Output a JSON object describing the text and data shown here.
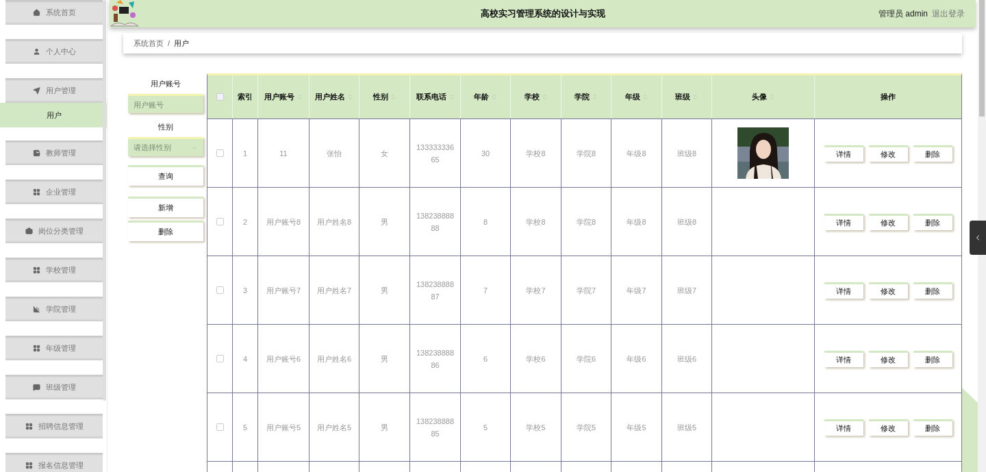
{
  "sidebar": {
    "items": [
      {
        "label": "系统首页",
        "selected": false
      },
      {
        "label": "个人中心",
        "selected": false
      },
      {
        "label": "用户管理",
        "selected": false,
        "expanded": true,
        "children": [
          {
            "label": "用户",
            "selected": true
          }
        ]
      },
      {
        "label": "教师管理",
        "selected": false
      },
      {
        "label": "企业管理",
        "selected": false
      },
      {
        "label": "岗位分类管理",
        "selected": false
      },
      {
        "label": "学校管理",
        "selected": false
      },
      {
        "label": "学院管理",
        "selected": false
      },
      {
        "label": "年级管理",
        "selected": false
      },
      {
        "label": "班级管理",
        "selected": false
      },
      {
        "label": "招聘信息管理",
        "selected": false
      },
      {
        "label": "报名信息管理",
        "selected": false
      }
    ]
  },
  "header": {
    "title": "高校实习管理系统的设计与实现",
    "user": "管理员 admin",
    "logout": "退出登录"
  },
  "breadcrumb": {
    "items": [
      "系统首页",
      "用户"
    ],
    "separator": "/"
  },
  "filters": [
    {
      "kind": "input",
      "label": "用户账号",
      "placeholder": "用户账号"
    },
    {
      "kind": "select",
      "label": "性别",
      "placeholder": "请选择性别"
    }
  ],
  "search_button": "查询",
  "actions": [
    "新增",
    "删除"
  ],
  "table": {
    "header_checked": false,
    "columns": [
      {
        "label": "索引",
        "sortable": false
      },
      {
        "label": "用户账号",
        "sortable": true
      },
      {
        "label": "用户姓名",
        "sortable": true
      },
      {
        "label": "性别",
        "sortable": true
      },
      {
        "label": "联系电话",
        "sortable": true
      },
      {
        "label": "年龄",
        "sortable": true
      },
      {
        "label": "学校",
        "sortable": true
      },
      {
        "label": "学院",
        "sortable": true
      },
      {
        "label": "年级",
        "sortable": true
      },
      {
        "label": "班级",
        "sortable": true
      },
      {
        "label": "头像",
        "sortable": true
      },
      {
        "label": "操作",
        "sortable": false
      }
    ],
    "rows": [
      {
        "checked": false,
        "cells": [
          "1",
          "11",
          "张怡",
          "女",
          "13333333665",
          "30",
          "学校8",
          "学院8",
          "年级8",
          "班级8"
        ],
        "avatar": true,
        "actions": [
          "详情",
          "修改",
          "删除"
        ]
      },
      {
        "checked": false,
        "cells": [
          "2",
          "用户账号8",
          "用户姓名8",
          "男",
          "13823888888",
          "8",
          "学校8",
          "学院8",
          "年级8",
          "班级8"
        ],
        "avatar": false,
        "actions": [
          "详情",
          "修改",
          "删除"
        ]
      },
      {
        "checked": false,
        "cells": [
          "3",
          "用户账号7",
          "用户姓名7",
          "男",
          "13823888887",
          "7",
          "学校7",
          "学院7",
          "年级7",
          "班级7"
        ],
        "avatar": false,
        "actions": [
          "详情",
          "修改",
          "删除"
        ]
      },
      {
        "checked": false,
        "cells": [
          "4",
          "用户账号6",
          "用户姓名6",
          "男",
          "13823888886",
          "6",
          "学校6",
          "学院6",
          "年级6",
          "班级6"
        ],
        "avatar": false,
        "actions": [
          "详情",
          "修改",
          "删除"
        ]
      },
      {
        "checked": false,
        "cells": [
          "5",
          "用户账号5",
          "用户姓名5",
          "男",
          "13823888885",
          "5",
          "学校5",
          "学院5",
          "年级5",
          "班级5"
        ],
        "avatar": false,
        "actions": [
          "详情",
          "修改",
          "删除"
        ]
      }
    ]
  }
}
